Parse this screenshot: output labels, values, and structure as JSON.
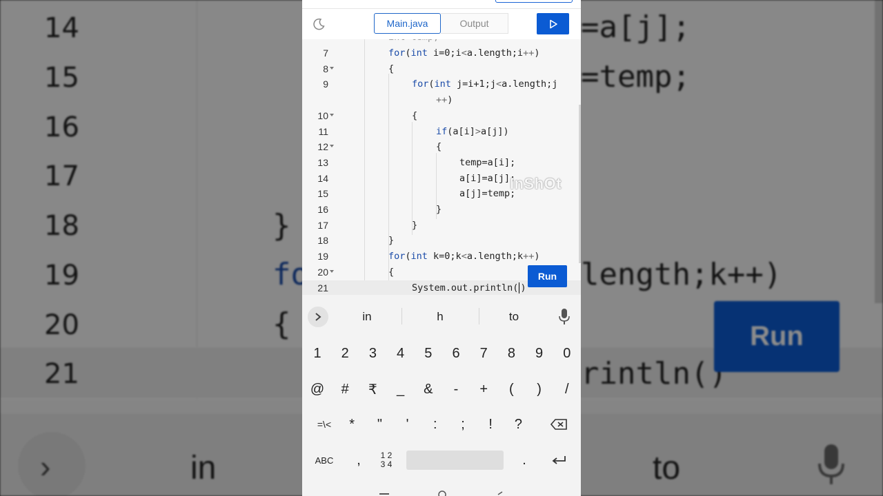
{
  "background": {
    "line_numbers": [
      "14",
      "15",
      "16",
      "17",
      "18",
      "19",
      "20",
      "21"
    ],
    "code_fragments": [
      "=a[j];",
      "=temp;",
      "}",
      "fo",
      "length;k++)",
      "{",
      "rintln()"
    ],
    "run_label": "Run",
    "suggestions": [
      "in",
      "to"
    ]
  },
  "header": {
    "tabs": [
      {
        "label": "Main.java",
        "active": true
      },
      {
        "label": "Output",
        "active": false
      }
    ]
  },
  "editor": {
    "lines": [
      {
        "n": "7",
        "fold": false,
        "code": "for(int i=0;i<a.length;i++)"
      },
      {
        "n": "8",
        "fold": true,
        "code": "{"
      },
      {
        "n": "9",
        "fold": false,
        "code": "for(int j=i+1;j<a.length;j"
      },
      {
        "n": "",
        "fold": false,
        "code": "++)"
      },
      {
        "n": "10",
        "fold": true,
        "code": "{"
      },
      {
        "n": "11",
        "fold": false,
        "code": "if(a[i]>a[j])"
      },
      {
        "n": "12",
        "fold": true,
        "code": "{"
      },
      {
        "n": "13",
        "fold": false,
        "code": "temp=a[i];"
      },
      {
        "n": "14",
        "fold": false,
        "code": "a[i]=a[j];"
      },
      {
        "n": "15",
        "fold": false,
        "code": "a[j]=temp;"
      },
      {
        "n": "16",
        "fold": false,
        "code": "}"
      },
      {
        "n": "17",
        "fold": false,
        "code": "}"
      },
      {
        "n": "18",
        "fold": false,
        "code": "}"
      },
      {
        "n": "19",
        "fold": false,
        "code": "for(int k=0;k<a.length;k++)"
      },
      {
        "n": "20",
        "fold": true,
        "code": "{"
      },
      {
        "n": "21",
        "fold": false,
        "code": "System.out.println()"
      }
    ],
    "current_line": "21",
    "run_label": "Run"
  },
  "keyboard": {
    "suggestions": [
      "in",
      "h",
      "to"
    ],
    "row_numbers": [
      "1",
      "2",
      "3",
      "4",
      "5",
      "6",
      "7",
      "8",
      "9",
      "0"
    ],
    "row_symbols1": [
      "@",
      "#",
      "₹",
      "_",
      "&",
      "-",
      "+",
      "(",
      ")",
      "/"
    ],
    "row_symbols2": [
      "=\\<",
      "*",
      "\"",
      "'",
      ":",
      ";",
      "!",
      "?"
    ],
    "abc_label": "ABC",
    "comma": ",",
    "numpad_label_top": "1 2",
    "numpad_label_bottom": "3 4",
    "period": ".",
    "watermark": "InShOt"
  },
  "colors": {
    "accent": "#0b5bd3",
    "keyword": "#1a4ba8"
  }
}
